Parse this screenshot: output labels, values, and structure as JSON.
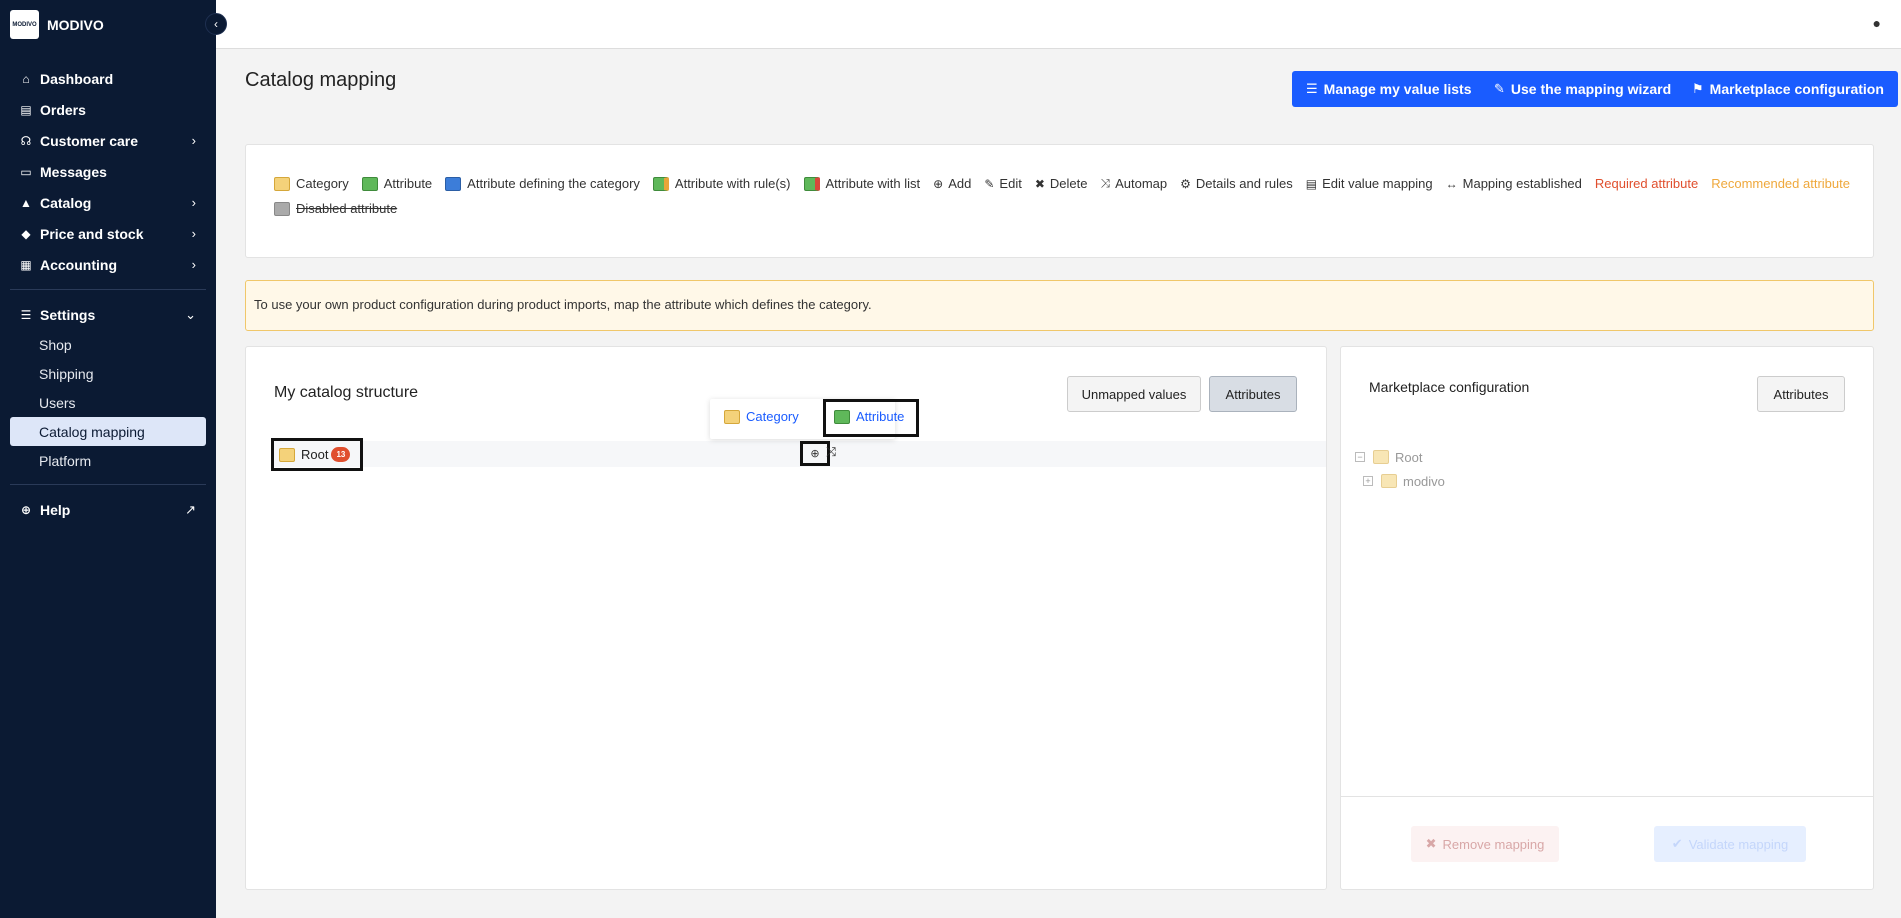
{
  "brand": {
    "logo_text": "MODIVO",
    "name": "MODIVO"
  },
  "sidebar": {
    "items": [
      {
        "label": "Dashboard",
        "icon": "home-icon"
      },
      {
        "label": "Orders",
        "icon": "clipboard-icon"
      },
      {
        "label": "Customer care",
        "icon": "headset-icon"
      },
      {
        "label": "Messages",
        "icon": "chat-icon"
      },
      {
        "label": "Catalog",
        "icon": "shapes-icon"
      },
      {
        "label": "Price and stock",
        "icon": "tag-icon"
      },
      {
        "label": "Accounting",
        "icon": "invoice-icon"
      }
    ],
    "settings": {
      "label": "Settings",
      "children": [
        "Shop",
        "Shipping",
        "Users",
        "Catalog mapping",
        "Platform"
      ],
      "active": "Catalog mapping"
    },
    "help": "Help"
  },
  "header": {
    "title": "Catalog mapping",
    "buttons": {
      "value_lists": "Manage my value lists",
      "wizard": "Use the mapping wizard",
      "marketplace": "Marketplace configuration"
    }
  },
  "legend": {
    "category": "Category",
    "attribute": "Attribute",
    "defining": "Attribute defining the category",
    "with_rules": "Attribute with rule(s)",
    "with_list": "Attribute with list",
    "add": "Add",
    "edit": "Edit",
    "delete": "Delete",
    "automap": "Automap",
    "details": "Details and rules",
    "edit_value": "Edit value mapping",
    "established": "Mapping established",
    "required": "Required attribute",
    "recommended": "Recommended attribute",
    "disabled": "Disabled attribute"
  },
  "notice": "To use your own product configuration during product imports, map the attribute which defines the category.",
  "catalog": {
    "title": "My catalog structure",
    "unmapped_btn": "Unmapped values",
    "attributes_btn": "Attributes",
    "root_label": "Root",
    "root_count": "13",
    "popup": {
      "category": "Category",
      "attribute": "Attribute"
    }
  },
  "marketplace": {
    "title": "Marketplace configuration",
    "attributes_btn": "Attributes",
    "tree": {
      "root": "Root",
      "child": "modivo"
    },
    "remove_btn": "Remove mapping",
    "validate_btn": "Validate mapping"
  },
  "colors": {
    "primary": "#1a5cff",
    "sidebar": "#0b1a33",
    "required": "#e04f2e",
    "recommended": "#efa83c",
    "notice_bg": "#fff8e8"
  }
}
